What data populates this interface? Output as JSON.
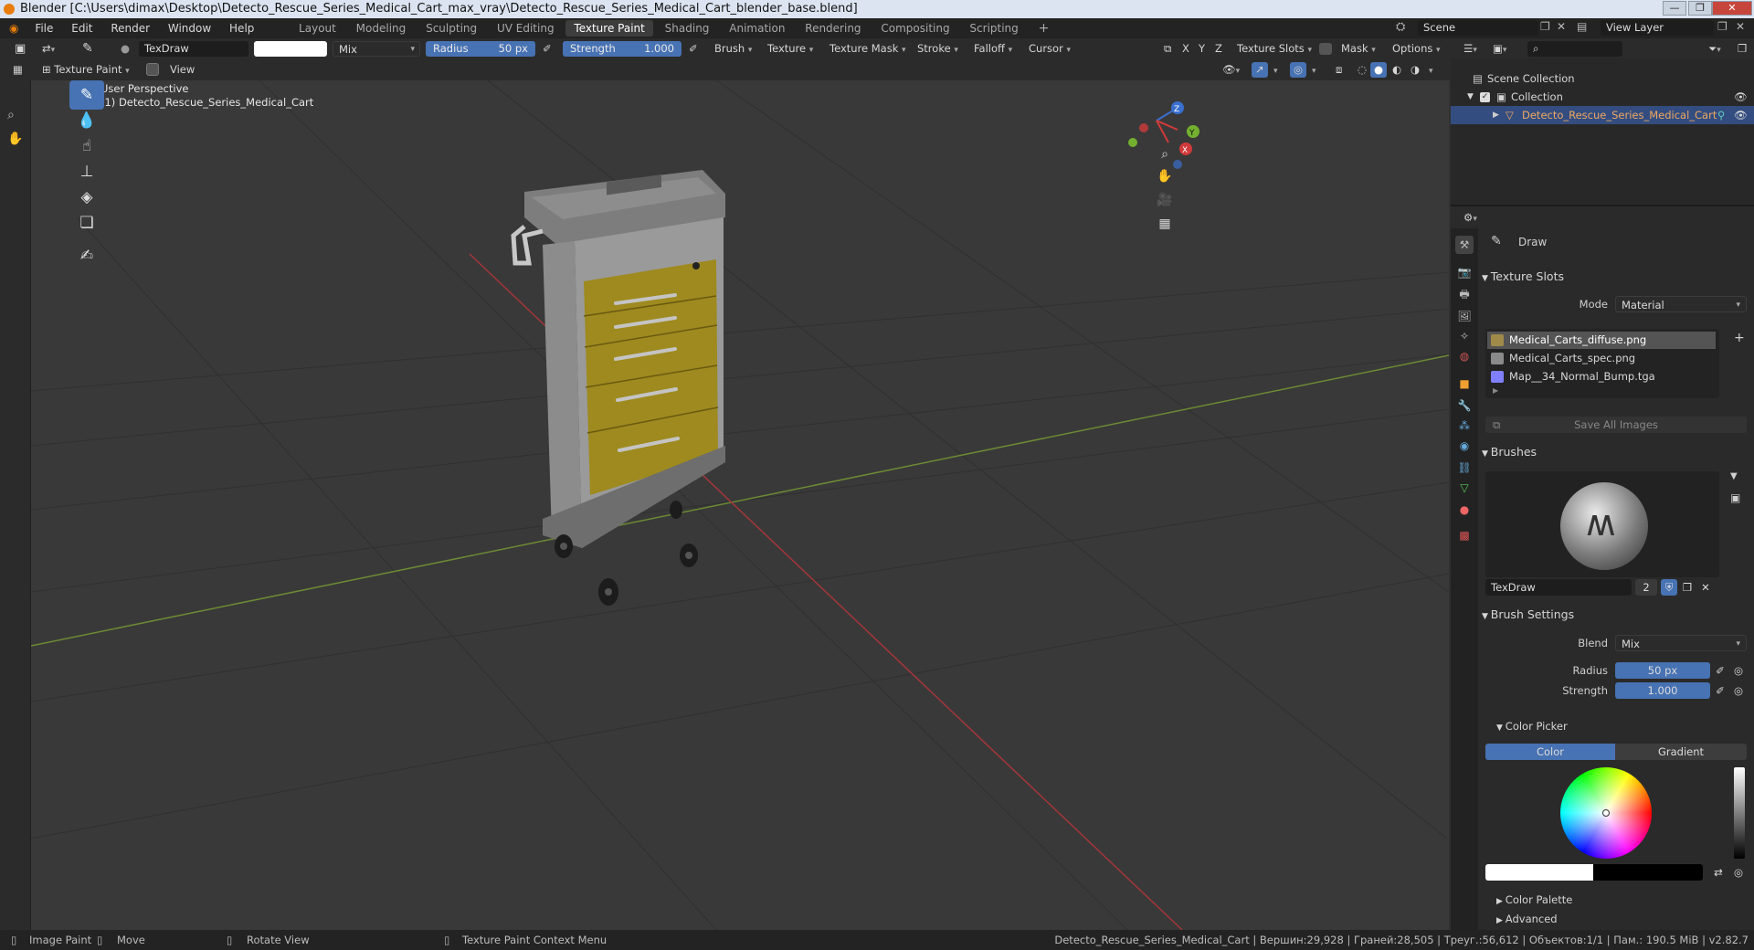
{
  "window": {
    "title": "Blender [C:\\Users\\dimax\\Desktop\\Detecto_Rescue_Series_Medical_Cart_max_vray\\Detecto_Rescue_Series_Medical_Cart_blender_base.blend]",
    "min": "—",
    "max": "❐",
    "close": "✕"
  },
  "menu": [
    "File",
    "Edit",
    "Render",
    "Window",
    "Help"
  ],
  "workspaces": [
    "Layout",
    "Modeling",
    "Sculpting",
    "UV Editing",
    "Texture Paint",
    "Shading",
    "Animation",
    "Rendering",
    "Compositing",
    "Scripting",
    "+"
  ],
  "active_workspace": "Texture Paint",
  "scene": {
    "label": "Scene",
    "view_layer": "View Layer"
  },
  "tool_header": {
    "brush_name": "TexDraw",
    "blend": "Mix",
    "radius_label": "Radius",
    "radius_value": "50 px",
    "strength_label": "Strength",
    "strength_value": "1.000",
    "menus": [
      "Brush",
      "Texture",
      "Texture Mask",
      "Stroke",
      "Falloff",
      "Cursor"
    ],
    "axes": [
      "X",
      "Y",
      "Z"
    ],
    "texture_slots": "Texture Slots",
    "mask": "Mask",
    "options": "Options"
  },
  "view_header": {
    "mode": "Texture Paint",
    "view": "View"
  },
  "viewport": {
    "perspective": "User Perspective",
    "object_label": "(1) Detecto_Rescue_Series_Medical_Cart"
  },
  "gizmo": {
    "x": "X",
    "y": "Y",
    "z": "Z"
  },
  "outliner": {
    "scene_collection": "Scene Collection",
    "collection": "Collection",
    "object": "Detecto_Rescue_Series_Medical_Cart"
  },
  "properties": {
    "tool_name": "Draw",
    "texture_slots": {
      "header": "Texture Slots",
      "mode_label": "Mode",
      "mode_value": "Material",
      "slots": [
        {
          "name": "Medical_Carts_diffuse.png",
          "color": "#a08a4a"
        },
        {
          "name": "Medical_Carts_spec.png",
          "color": "#8a8a8a"
        },
        {
          "name": "Map__34_Normal_Bump.tga",
          "color": "#8080ff"
        }
      ],
      "save_all": "Save All Images"
    },
    "brushes": {
      "header": "Brushes",
      "brush_name": "TexDraw",
      "users": "2"
    },
    "brush_settings": {
      "header": "Brush Settings",
      "blend_label": "Blend",
      "blend_value": "Mix",
      "radius_label": "Radius",
      "radius_value": "50 px",
      "strength_label": "Strength",
      "strength_value": "1.000"
    },
    "color_picker": {
      "header": "Color Picker",
      "tab_color": "Color",
      "tab_gradient": "Gradient"
    },
    "color_palette": "Color Palette",
    "advanced": "Advanced"
  },
  "status": {
    "image_paint": "Image Paint",
    "move": "Move",
    "rotate": "Rotate View",
    "context": "Texture Paint Context Menu",
    "stats": "Detecto_Rescue_Series_Medical_Cart | Вершин:29,928 | Граней:28,505 | Треуг.:56,612 | Объектов:1/1 | Пам.: 190.5 MiB | v2.82.7"
  }
}
